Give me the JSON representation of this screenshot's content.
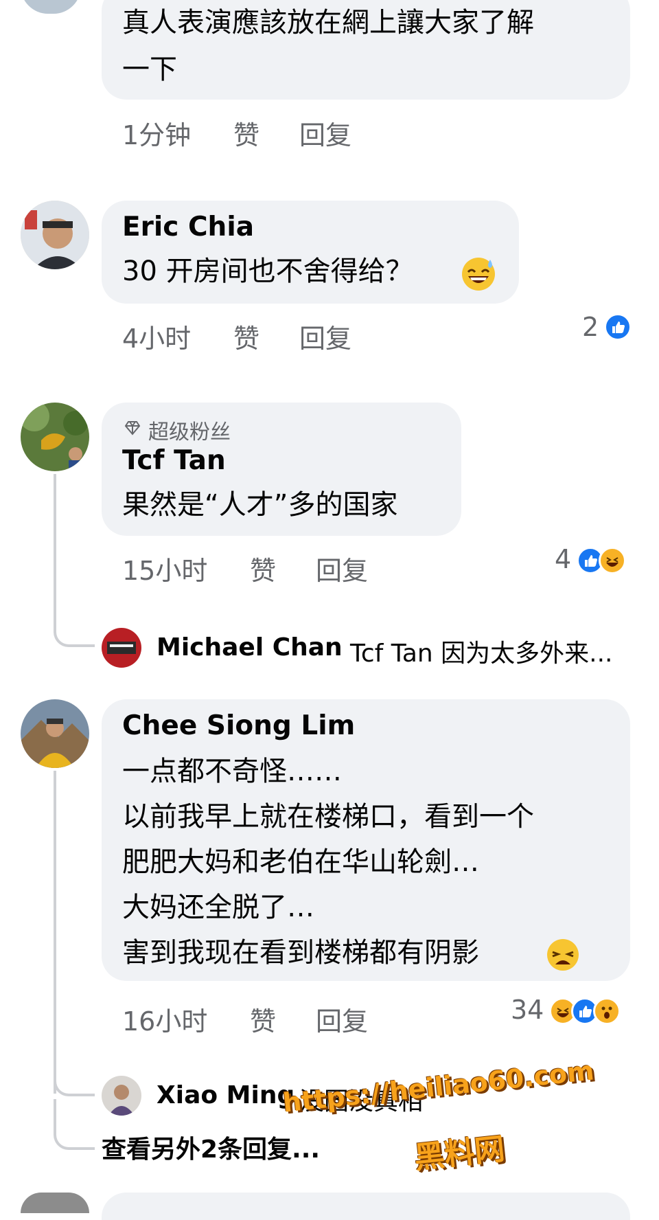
{
  "comments": [
    {
      "text_lines": [
        "真人表演應該放在網上讓大家了解",
        "一下"
      ],
      "time": "1分钟",
      "like_label": "赞",
      "reply_label": "回复"
    },
    {
      "author": "Eric Chia",
      "text_lines": [
        "30 开房间也不舍得给？"
      ],
      "time": "4小时",
      "like_label": "赞",
      "reply_label": "回复",
      "reaction_count": "2",
      "reactions": [
        "like"
      ]
    },
    {
      "badge": "超级粉丝",
      "author": "Tcf Tan",
      "text_lines": [
        "果然是“人才”多的国家"
      ],
      "time": "15小时",
      "like_label": "赞",
      "reply_label": "回复",
      "reaction_count": "4",
      "reactions": [
        "like",
        "haha"
      ],
      "reply_preview": {
        "author": "Michael Chan",
        "text": "Tcf Tan 因为太多外来..."
      }
    },
    {
      "author": "Chee Siong Lim",
      "text_lines": [
        "一点都不奇怪……",
        "以前我早上就在楼梯口，看到一个",
        "肥肥大妈和老伯在华山轮劍…",
        "大妈还全脱了…",
        "害到我现在看到楼梯都有阴影"
      ],
      "time": "16小时",
      "like_label": "赞",
      "reply_label": "回复",
      "reaction_count": "34",
      "reactions": [
        "haha",
        "like",
        "wow"
      ],
      "reply_preview": {
        "author": "Xiao Ming",
        "text": "没图没真相"
      },
      "more_replies": "查看另外2条回复..."
    }
  ],
  "watermark": {
    "url": "https://heiliao60.com",
    "name": "黑料网"
  },
  "colors": {
    "bubble": "#f0f2f5",
    "meta": "#65676b",
    "like": "#1877f2",
    "emoji": "#f7b125"
  }
}
